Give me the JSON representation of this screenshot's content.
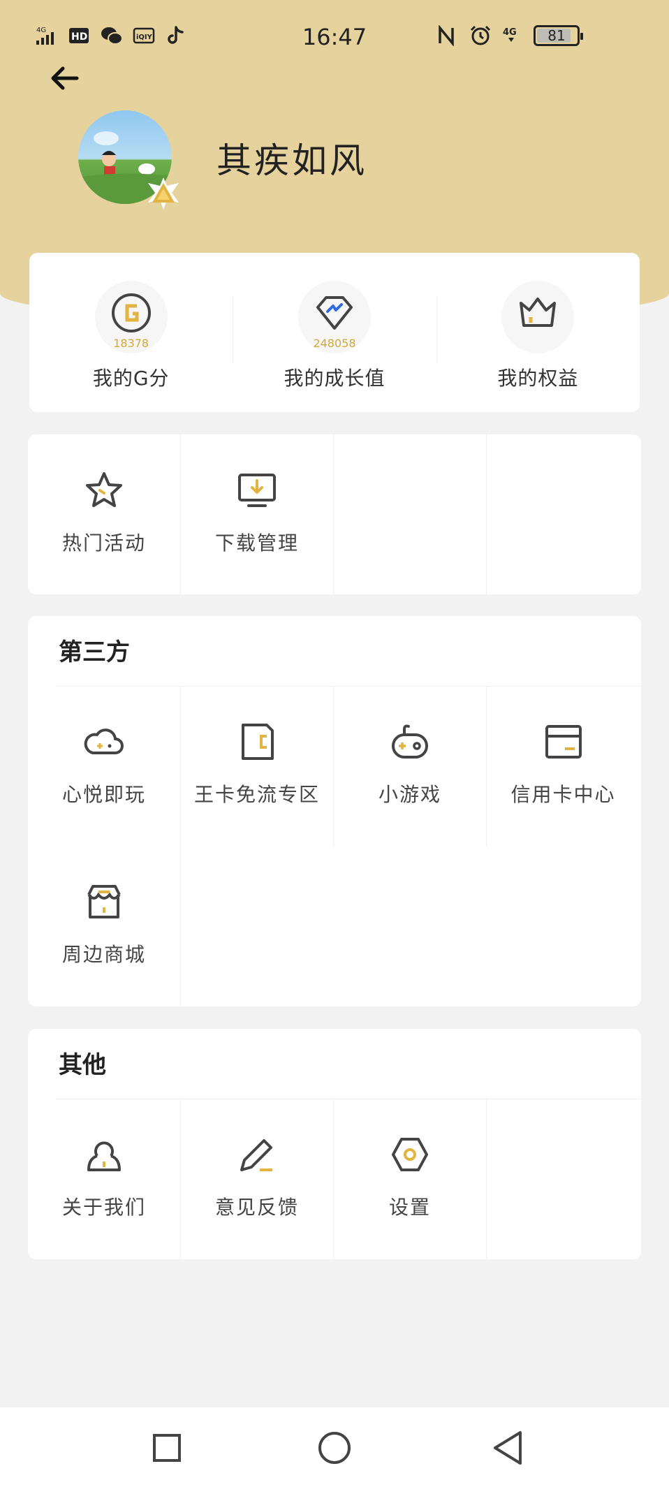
{
  "status_bar": {
    "time": "16:47",
    "left_icons": [
      "4g-signal-icon",
      "hd-icon",
      "wechat-icon",
      "iqiyi-icon",
      "tiktok-icon"
    ],
    "right_icons": [
      "nfc-icon",
      "alarm-icon",
      "4g-icon"
    ],
    "battery": "81"
  },
  "profile": {
    "username": "其疾如风"
  },
  "stats": [
    {
      "value": "18378",
      "label": "我的G分",
      "icon": "g-score-icon"
    },
    {
      "value": "248058",
      "label": "我的成长值",
      "icon": "diamond-growth-icon"
    },
    {
      "label": "我的权益",
      "icon": "crown-icon"
    }
  ],
  "tools": [
    {
      "label": "热门活动",
      "icon": "star-icon"
    },
    {
      "label": "下载管理",
      "icon": "download-monitor-icon"
    }
  ],
  "third_party": {
    "title": "第三方",
    "items": [
      {
        "label": "心悦即玩",
        "icon": "cloud-gamepad-icon"
      },
      {
        "label": "王卡免流专区",
        "icon": "sim-card-icon"
      },
      {
        "label": "小游戏",
        "icon": "gamepad-icon"
      },
      {
        "label": "信用卡中心",
        "icon": "credit-card-icon"
      },
      {
        "label": "周边商城",
        "icon": "shop-icon"
      }
    ]
  },
  "others": {
    "title": "其他",
    "items": [
      {
        "label": "关于我们",
        "icon": "user-icon"
      },
      {
        "label": "意见反馈",
        "icon": "pencil-icon"
      },
      {
        "label": "设置",
        "icon": "settings-hexagon-icon"
      }
    ]
  },
  "colors": {
    "header_bg": "#e6d29c",
    "accent": "#e2b441",
    "page_bg": "#f2f2f2"
  }
}
